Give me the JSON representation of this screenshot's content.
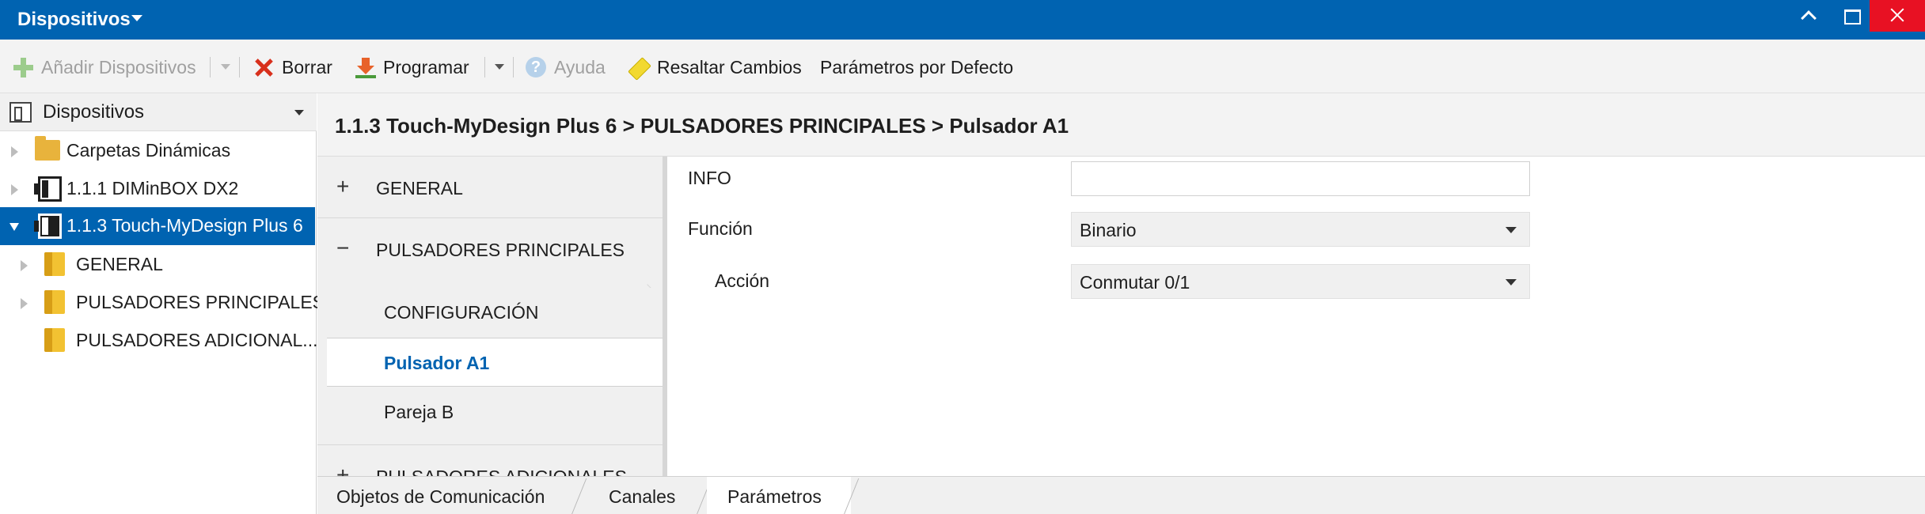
{
  "window": {
    "title": "Dispositivos"
  },
  "toolbar": {
    "add_devices": "Añadir Dispositivos",
    "delete": "Borrar",
    "program": "Programar",
    "help": "Ayuda",
    "highlight_changes": "Resaltar Cambios",
    "default_params": "Parámetros por Defecto"
  },
  "sidebar": {
    "header": "Dispositivos",
    "items": [
      {
        "label": "Carpetas Dinámicas",
        "icon": "folder-icon"
      },
      {
        "label": "1.1.1 DIMinBOX DX2",
        "icon": "device-icon"
      },
      {
        "label": "1.1.3 Touch-MyDesign Plus 6",
        "icon": "device-icon",
        "selected": true
      },
      {
        "label": "GENERAL",
        "icon": "folder-icon"
      },
      {
        "label": "PULSADORES PRINCIPALES",
        "icon": "folder-icon"
      },
      {
        "label": "PULSADORES ADICIONAL...",
        "icon": "folder-icon"
      }
    ]
  },
  "breadcrumb": "1.1.3 Touch-MyDesign Plus 6 > PULSADORES PRINCIPALES > Pulsador A1",
  "nav": {
    "general": {
      "sign": "+",
      "label": "GENERAL"
    },
    "principales": {
      "sign": "−",
      "label": "PULSADORES PRINCIPALES"
    },
    "sub": [
      "CONFIGURACIÓN",
      "Pulsador A1",
      "Pareja B"
    ],
    "adicionales": {
      "sign": "+",
      "label": "PULSADORES ADICIONALES"
    }
  },
  "params": {
    "info_label": "INFO",
    "info_value": "",
    "funcion_label": "Función",
    "funcion_value": "Binario",
    "accion_label": "Acción",
    "accion_value": "Conmutar 0/1"
  },
  "tabs": [
    "Objetos de Comunicación",
    "Canales",
    "Parámetros"
  ],
  "colors": {
    "accent": "#0063b1",
    "close": "#e81123"
  }
}
